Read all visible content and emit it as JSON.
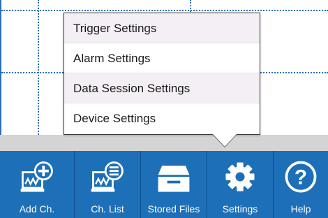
{
  "settings_menu": {
    "items": [
      {
        "label": "Trigger Settings"
      },
      {
        "label": "Alarm Settings"
      },
      {
        "label": "Data Session Settings"
      },
      {
        "label": "Device Settings"
      }
    ]
  },
  "toolbar": {
    "buttons": [
      {
        "label": "Add Ch.",
        "icon": "add-channel-icon"
      },
      {
        "label": "Ch. List",
        "icon": "channel-list-icon"
      },
      {
        "label": "Stored Files",
        "icon": "stored-files-icon"
      },
      {
        "label": "Settings",
        "icon": "gear-icon"
      },
      {
        "label": "Help",
        "icon": "help-icon"
      }
    ]
  },
  "colors": {
    "toolbar_background": "#1d6fb8",
    "grid_line": "#2c6fb8",
    "separator_band": "#d4d4d4",
    "menu_shaded_item": "#f4eff4"
  }
}
